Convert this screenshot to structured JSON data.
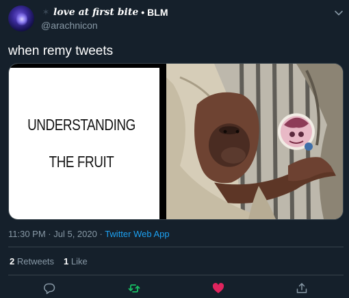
{
  "tweet": {
    "author": {
      "display_name": "love at first bite",
      "separator": " • ",
      "badge": "BLM",
      "handle": "@arachnicon"
    },
    "text": "when remy tweets",
    "media": {
      "meme_left_line1": "UNDERSTANDING",
      "meme_left_line2": "THE FRUIT"
    },
    "time": "11:30 PM",
    "date": "Jul 5, 2020",
    "meta_separator": " · ",
    "source": "Twitter Web App",
    "stats": {
      "retweets_count": "2",
      "retweets_label": " Retweets",
      "likes_count": "1",
      "likes_label": " Like"
    }
  },
  "icons": {
    "reply": "reply-icon",
    "retweet": "retweet-icon",
    "like": "heart-icon",
    "share": "share-icon",
    "menu": "chevron-down-icon"
  },
  "colors": {
    "background": "#15202b",
    "accent": "#1da1f2",
    "retweet_active": "#17bf63",
    "like_active": "#e0245e",
    "muted": "#8899a6"
  }
}
